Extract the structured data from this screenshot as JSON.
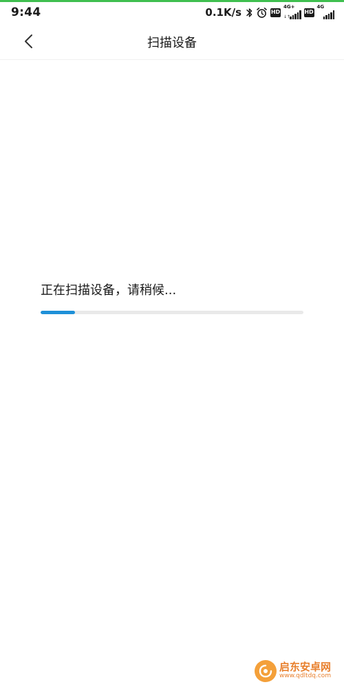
{
  "status_bar": {
    "time": "9:44",
    "net_speed": "0.1K/s",
    "icons": [
      "bluetooth-icon",
      "alarm-icon",
      "hd-icon",
      "signal-4g-plus-icon",
      "hd-icon",
      "signal-4g-icon"
    ],
    "hd_label": "HD",
    "sim1_network": "4G+",
    "sim1_sub": "↓↑",
    "sim2_network": "4G"
  },
  "nav": {
    "title": "扫描设备",
    "back_icon": "chevron-left-icon"
  },
  "scan": {
    "message": "正在扫描设备，请稍候...",
    "progress": 0.13,
    "progress_color": "#1e90d8",
    "track_color": "#e9e9e9"
  },
  "watermark": {
    "title": "启东安卓网",
    "url": "www.qdltdq.com",
    "color": "#e8802e"
  }
}
